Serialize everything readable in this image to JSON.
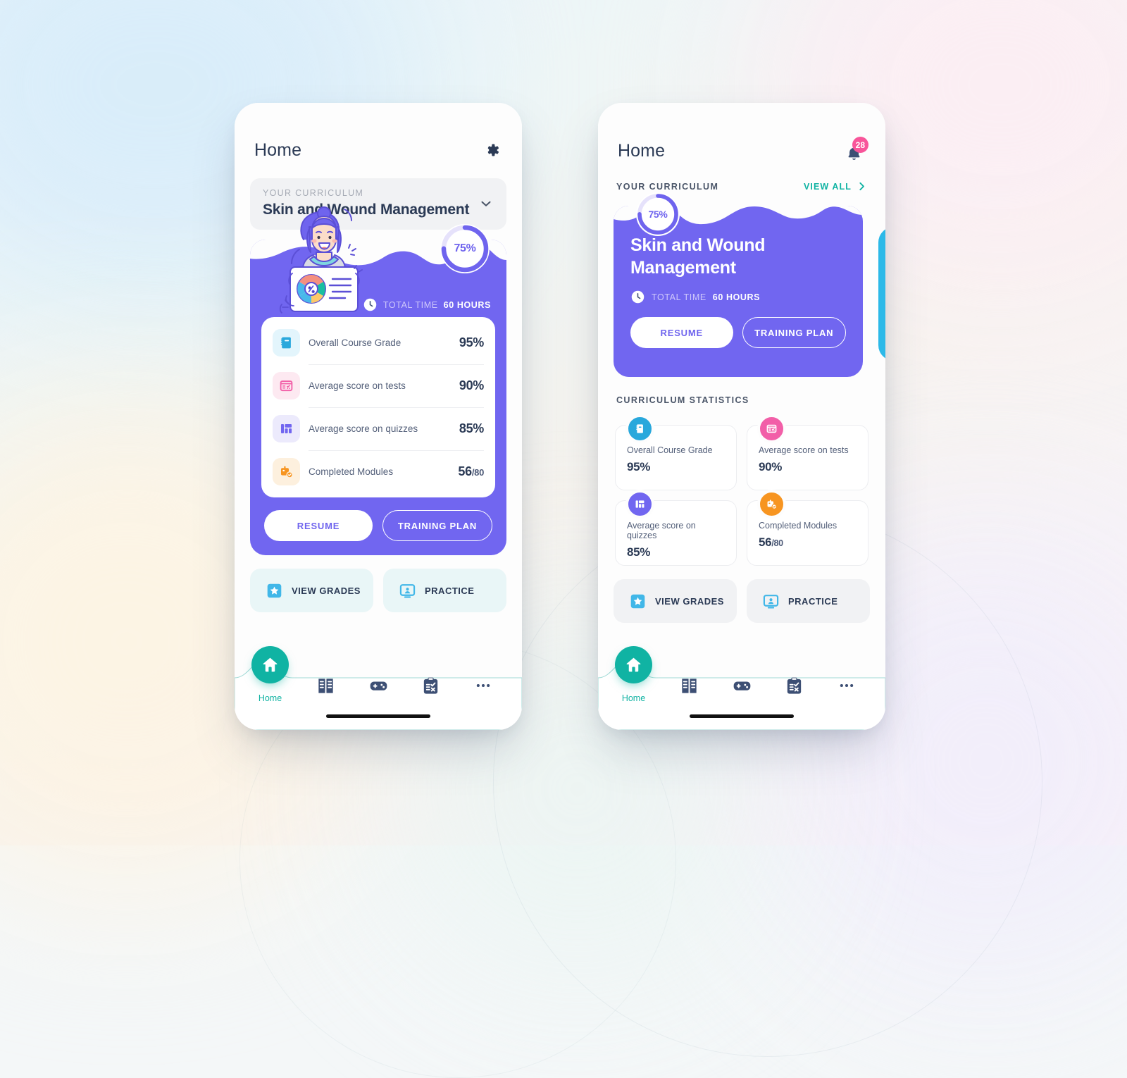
{
  "background": {
    "tints": [
      "#e8f4fb",
      "#fdf4e4",
      "#fceef4",
      "#f1eefb"
    ]
  },
  "theme": {
    "purple": "#7166f0",
    "teal": "#10b3a3",
    "pink": "#f8559a",
    "cyan": "#2cb9e8",
    "orange": "#f79521",
    "ink": "#2b3a55"
  },
  "left_phone": {
    "header": {
      "title": "Home",
      "settings_icon": "gear-icon"
    },
    "selector": {
      "label": "YOUR CURRICULUM",
      "value": "Skin and Wound Management",
      "chevron_icon": "chevron-down-icon"
    },
    "hero": {
      "progress_percent": "75%",
      "progress_value": 75,
      "total_time_label": "TOTAL TIME",
      "total_time_value": "60 HOURS",
      "clock_icon": "clock-icon",
      "illustration": "student-holding-report-illustration"
    },
    "stats": [
      {
        "icon": "book-icon",
        "name": "Overall Course Grade",
        "value": "95%",
        "sub": ""
      },
      {
        "icon": "test-icon",
        "name": "Average score on tests",
        "value": "90%",
        "sub": ""
      },
      {
        "icon": "quiz-icon",
        "name": "Average score on quizzes",
        "value": "85%",
        "sub": ""
      },
      {
        "icon": "modules-icon",
        "name": "Completed Modules",
        "value": "56",
        "sub": "/80"
      }
    ],
    "buttons": {
      "resume": "RESUME",
      "training_plan": "TRAINING PLAN"
    },
    "quick_actions": [
      {
        "icon": "star-badge-icon",
        "label": "VIEW GRADES"
      },
      {
        "icon": "monitor-user-icon",
        "label": "PRACTICE"
      }
    ],
    "nav": {
      "home_label": "Home",
      "items": [
        "home-icon",
        "books-icon",
        "gamepad-icon",
        "clipboard-check-icon",
        "more-dots-icon"
      ]
    }
  },
  "right_phone": {
    "header": {
      "title": "Home",
      "bell_icon": "bell-icon",
      "notification_count": "28"
    },
    "section": {
      "title": "YOUR CURRICULUM",
      "view_all": "VIEW ALL",
      "chevron_icon": "chevron-right-icon"
    },
    "card": {
      "progress_percent": "75%",
      "progress_value": 75,
      "title": "Skin and Wound Management",
      "total_time_label": "TOTAL TIME",
      "total_time_value": "60 HOURS",
      "clock_icon": "clock-icon",
      "resume": "RESUME",
      "training_plan": "TRAINING PLAN"
    },
    "stats_section_title": "CURRICULUM STATISTICS",
    "stats": [
      {
        "icon": "book-icon",
        "color": "#29a8dc",
        "name": "Overall Course Grade",
        "value": "95%",
        "sub": ""
      },
      {
        "icon": "test-icon",
        "color": "#f25fa8",
        "name": "Average score on tests",
        "value": "90%",
        "sub": ""
      },
      {
        "icon": "quiz-icon",
        "color": "#7166f0",
        "name": "Average score on quizzes",
        "value": "85%",
        "sub": ""
      },
      {
        "icon": "modules-icon",
        "color": "#f79521",
        "name": "Completed Modules",
        "value": "56",
        "sub": "/80"
      }
    ],
    "quick_actions": [
      {
        "icon": "star-badge-icon",
        "label": "VIEW GRADES"
      },
      {
        "icon": "monitor-user-icon",
        "label": "PRACTICE"
      }
    ],
    "nav": {
      "home_label": "Home",
      "items": [
        "home-icon",
        "books-icon",
        "gamepad-icon",
        "clipboard-check-icon",
        "more-dots-icon"
      ]
    }
  }
}
